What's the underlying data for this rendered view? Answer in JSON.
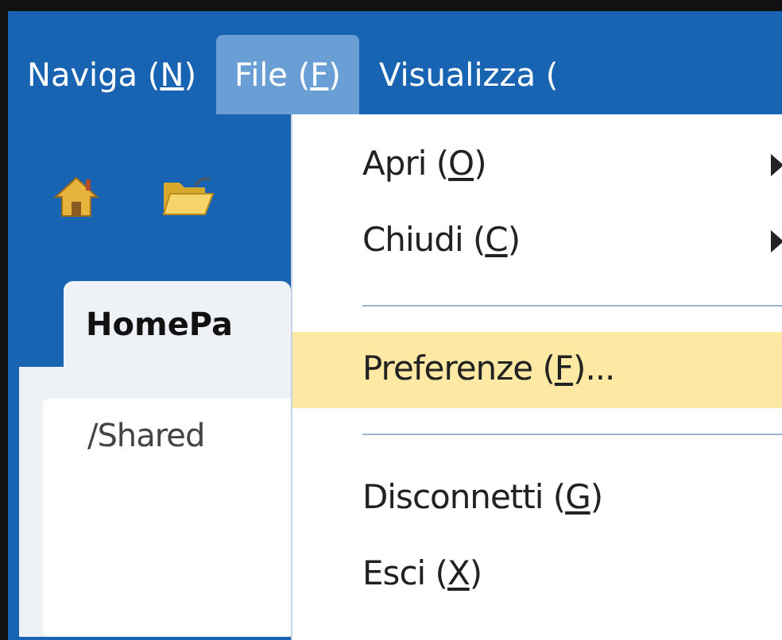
{
  "menubar": [
    {
      "before": "Naviga (",
      "key": "N",
      "after": ")",
      "selected": false
    },
    {
      "before": "File (",
      "key": "F",
      "after": ")",
      "selected": true
    },
    {
      "before": "Visualizza (",
      "selected": false
    }
  ],
  "toolbar": [
    {
      "kind": "home"
    },
    {
      "kind": "folder"
    }
  ],
  "tabs": [
    {
      "label": "HomePa",
      "selected": true
    }
  ],
  "content": {
    "path": "/Shared"
  },
  "file_menu": [
    {
      "kind": "item",
      "before": "Apri (",
      "key": "O",
      "after": ")",
      "submenu": true,
      "selected": false
    },
    {
      "kind": "item",
      "before": "Chiudi (",
      "key": "C",
      "after": ")",
      "submenu": true,
      "selected": false
    },
    {
      "kind": "separator"
    },
    {
      "kind": "item",
      "before": "Preferenze (",
      "key": "F",
      "after": ")...",
      "submenu": false,
      "selected": true
    },
    {
      "kind": "separator"
    },
    {
      "kind": "item",
      "before": "Disconnetti (",
      "key": "G",
      "after": ")",
      "submenu": false,
      "selected": false
    },
    {
      "kind": "item",
      "before": "Esci (",
      "key": "X",
      "after": ")",
      "submenu": false,
      "selected": false
    }
  ]
}
